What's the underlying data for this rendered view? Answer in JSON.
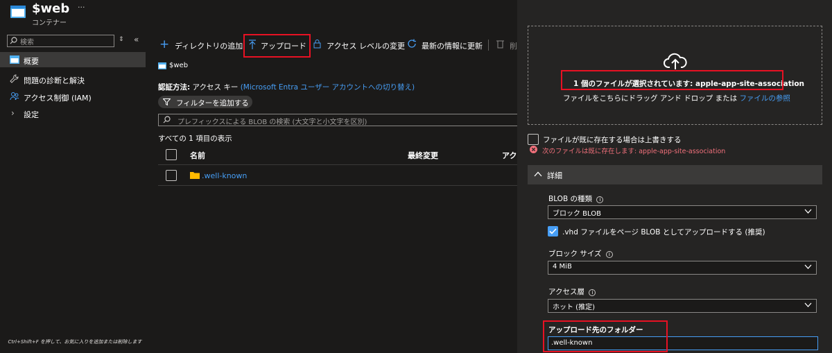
{
  "header": {
    "title": "$web",
    "subtitle": "コンテナー",
    "more": "···"
  },
  "sidebar": {
    "search_placeholder": "検索",
    "items": [
      {
        "label": "概要",
        "icon": "overview-icon"
      },
      {
        "label": "問題の診断と解決",
        "icon": "wrench-icon"
      },
      {
        "label": "アクセス制御 (IAM)",
        "icon": "people-icon"
      },
      {
        "label": "設定",
        "icon": "chevron-right-icon"
      }
    ],
    "hint": "Ctrl+Shift+F を押して、お気に入りを追加または削除します"
  },
  "toolbar": {
    "add_directory": "ディレクトリの追加",
    "upload": "アップロード",
    "access_level": "アクセス レベルの変更",
    "refresh": "最新の情報に更新",
    "delete": "削"
  },
  "main": {
    "breadcrumb": "$web",
    "auth_label": "認証方法:",
    "auth_value": "アクセス キー",
    "auth_switch": "(Microsoft Entra ユーザー アカウントへの切り替え)",
    "filter_button": "フィルターを追加する",
    "search_placeholder": "プレフィックスによる BLOB の検索 (大文字と小文字を区別)",
    "count": "すべての 1 項目の表示",
    "columns": [
      "名前",
      "最終変更",
      "アク"
    ],
    "rows": [
      {
        "name": ".well-known"
      }
    ]
  },
  "upload_panel": {
    "selected_text": "1 個のファイルが選択されています: apple-app-site-association",
    "drop_text": "ファイルをこちらにドラッグ アンド ドロップ または",
    "browse_link": "ファイルの参照",
    "overwrite_label": "ファイルが既に存在する場合は上書きする",
    "error_text": "次のファイルは既に存在します: apple-app-site-association",
    "details_title": "詳細",
    "blob_type_label": "BLOB の種類",
    "blob_type_value": "ブロック BLOB",
    "vhd_label": ".vhd ファイルをページ BLOB としてアップロードする (推奨)",
    "block_size_label": "ブロック サイズ",
    "block_size_value": "4 MiB",
    "access_tier_label": "アクセス層",
    "access_tier_value": "ホット (推定)",
    "folder_label": "アップロード先のフォルダー",
    "folder_value": ".well-known"
  },
  "colors": {
    "background": "#1b1a19",
    "panel": "#252423",
    "accent": "#479ef5",
    "highlight": "#e81123",
    "error": "#f1707b",
    "folder": "#ffb900"
  }
}
